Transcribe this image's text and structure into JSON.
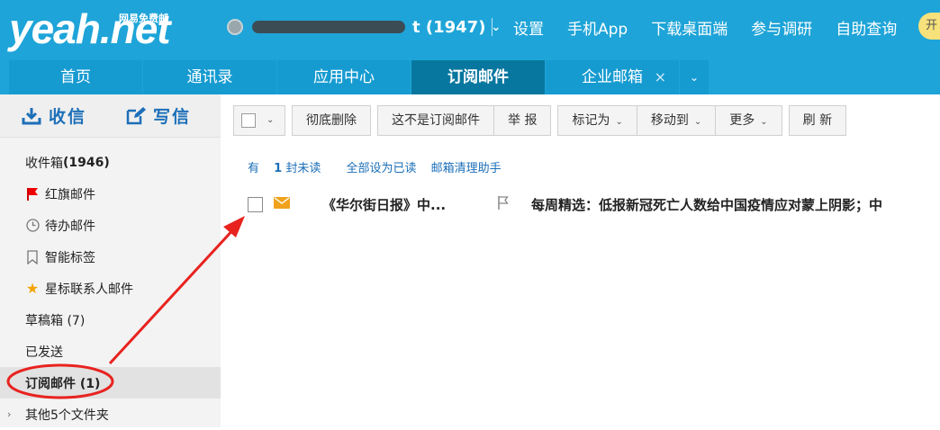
{
  "logo": {
    "brand": "yeah.net",
    "slogan": "网易免费邮"
  },
  "account": {
    "count_label": "t (1947)"
  },
  "toplinks": [
    "设置",
    "手机App",
    "下载桌面端",
    "参与调研",
    "自助查询"
  ],
  "open_button": "开",
  "tabs": [
    {
      "label": "首页"
    },
    {
      "label": "通讯录"
    },
    {
      "label": "应用中心"
    },
    {
      "label": "订阅邮件",
      "active": true
    },
    {
      "label": "企业邮箱",
      "closable": true
    }
  ],
  "sidebar": {
    "receive": "收信",
    "compose": "写信",
    "folders": [
      {
        "label": "收件箱 ",
        "count": "(1946)",
        "icon": ""
      },
      {
        "label": "红旗邮件",
        "icon": "red-flag-icon"
      },
      {
        "label": "待办邮件",
        "icon": "clock-icon"
      },
      {
        "label": "智能标签",
        "icon": "bookmark-icon"
      },
      {
        "label": "星标联系人邮件",
        "icon": "star-icon"
      },
      {
        "label": "草稿箱 (7)"
      },
      {
        "label": "已发送"
      },
      {
        "label": "订阅邮件 (1)",
        "active": true
      },
      {
        "label": "其他5个文件夹",
        "expandable": true
      }
    ]
  },
  "toolbar": {
    "delete_all": "彻底删除",
    "not_subscription": "这不是订阅邮件",
    "report": "举 报",
    "mark_as": "标记为",
    "move_to": "移动到",
    "more": "更多",
    "refresh": "刷 新"
  },
  "info": {
    "unread_prefix": "有",
    "unread_count": "1",
    "unread_suffix": "封未读",
    "mark_all_read": "全部设为已读",
    "cleanup": "邮箱清理助手"
  },
  "mail": {
    "from": "《华尔街日报》中...",
    "subject": "每周精选：低报新冠死亡人数给中国疫情应对蒙上阴影；中"
  },
  "colors": {
    "topbar": "#1ea4d8",
    "active_tab": "#08779f",
    "link": "#1c6fb8",
    "annotation": "#e8231f"
  }
}
